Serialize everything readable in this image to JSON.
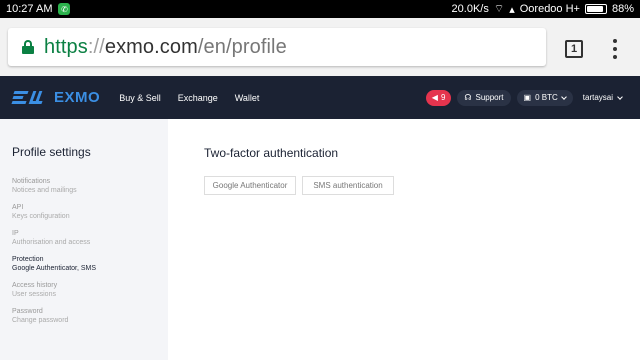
{
  "status_bar": {
    "time": "10:27 AM",
    "network_speed": "20.0K/s",
    "carrier": "Ooredoo H+",
    "battery": "88%",
    "battery_level": 0.88
  },
  "browser": {
    "url_scheme": "https",
    "url_separator": "://",
    "url_host": "exmo.com",
    "url_path": "/en/profile",
    "tab_count": "1"
  },
  "header": {
    "logo_text": "EXMO",
    "nav": [
      "Buy & Sell",
      "Exchange",
      "Wallet"
    ],
    "notifications_count": "9",
    "support_label": "Support",
    "balance_label": "0 BTC",
    "username": "tartaysai"
  },
  "sidebar": {
    "title": "Profile settings",
    "items": [
      {
        "title": "Notifications",
        "subtitle": "Notices and mailings"
      },
      {
        "title": "API",
        "subtitle": "Keys configuration"
      },
      {
        "title": "IP",
        "subtitle": "Authorisation and access"
      },
      {
        "title": "Protection",
        "subtitle": "Google Authenticator, SMS"
      },
      {
        "title": "Access history",
        "subtitle": "User sessions"
      },
      {
        "title": "Password",
        "subtitle": "Change password"
      }
    ]
  },
  "main": {
    "title": "Two-factor authentication",
    "tabs": [
      "Google Authenticator",
      "SMS authentication"
    ]
  },
  "colors": {
    "header_bg": "#1b2233",
    "brand_blue": "#3b8fe4",
    "notification_red": "#e5344e",
    "secure_green": "#0b8043"
  }
}
